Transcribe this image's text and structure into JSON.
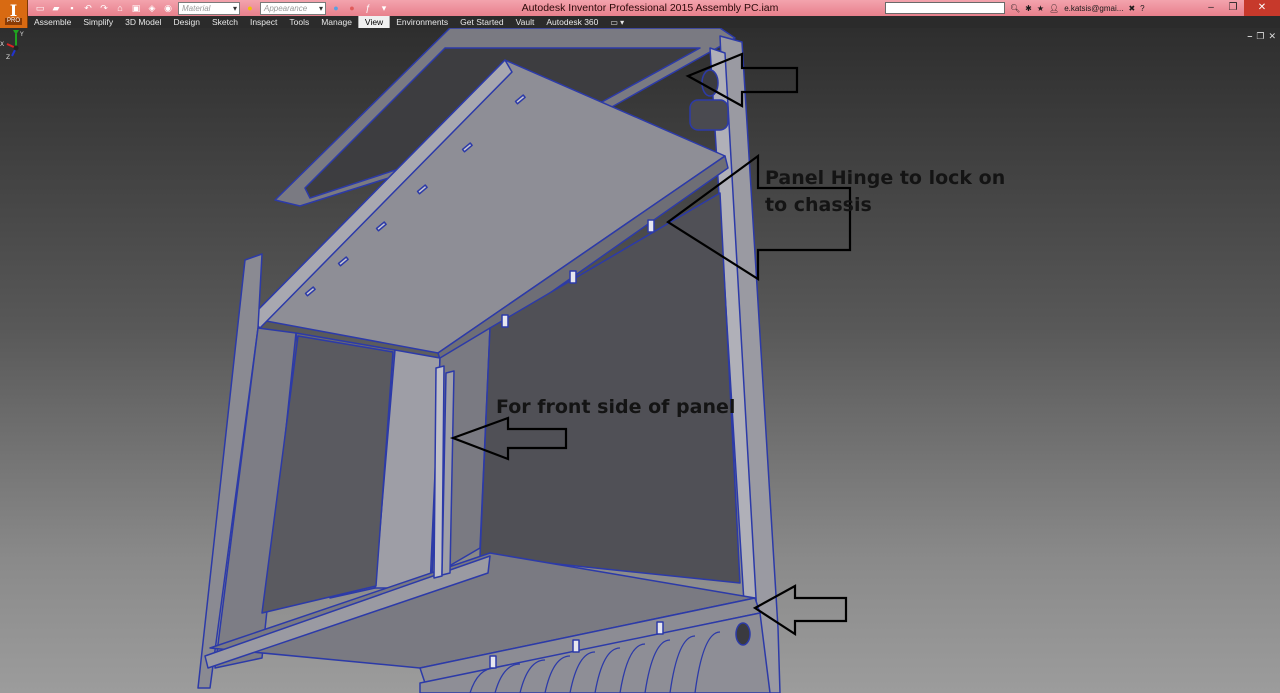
{
  "app": {
    "title": "Autodesk Inventor Professional 2015   Assembly PC.iam",
    "logo_badge": "PRO",
    "user": "e.katsis@gmai...",
    "search_placeholder": ""
  },
  "quick_access": {
    "material": {
      "value": "Material"
    },
    "appearance": {
      "value": "Appearance"
    }
  },
  "ribbon": {
    "tabs": [
      "Assemble",
      "Simplify",
      "3D Model",
      "Design",
      "Sketch",
      "Inspect",
      "Tools",
      "Manage",
      "View",
      "Environments",
      "Get Started",
      "Vault",
      "Autodesk 360"
    ],
    "active_tab": "View"
  },
  "viewport": {
    "annotations": {
      "hinge": "Panel Hinge to lock on to chassis",
      "front_side": "For front side of panel"
    },
    "triad_labels": {
      "x": "X",
      "y": "Y",
      "z": "Z"
    }
  },
  "colors": {
    "titlebar": "#e8808c",
    "tabbar": "#2b2b2b",
    "model_edge": "#2c3aa8",
    "model_face": "#8e8e96",
    "arrow": "#000000"
  }
}
